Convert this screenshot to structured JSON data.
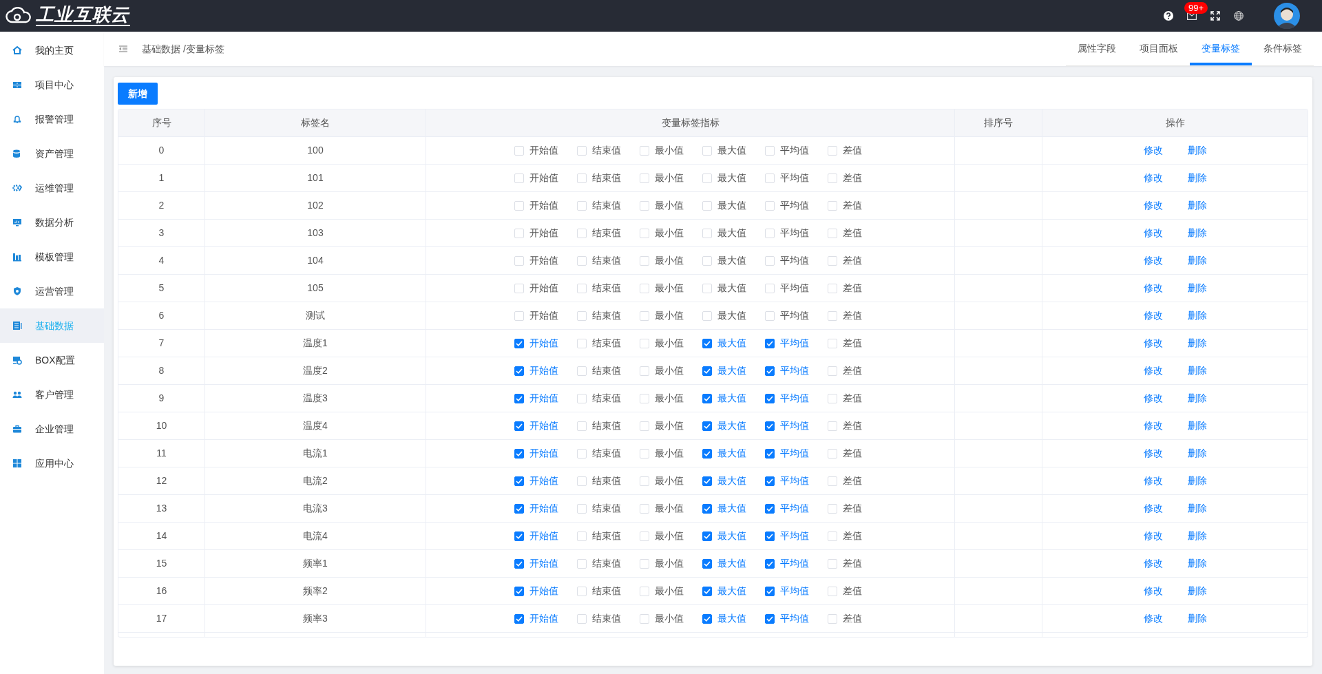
{
  "header": {
    "logo": "工业互联云",
    "notification_badge": "99+"
  },
  "sidebar": {
    "items": [
      {
        "label": "我的主页",
        "selected": false
      },
      {
        "label": "项目中心",
        "selected": false
      },
      {
        "label": "报警管理",
        "selected": false
      },
      {
        "label": "资产管理",
        "selected": false
      },
      {
        "label": "运维管理",
        "selected": false
      },
      {
        "label": "数据分析",
        "selected": false
      },
      {
        "label": "模板管理",
        "selected": false
      },
      {
        "label": "运营管理",
        "selected": false
      },
      {
        "label": "基础数据",
        "selected": true
      },
      {
        "label": "BOX配置",
        "selected": false
      },
      {
        "label": "客户管理",
        "selected": false
      },
      {
        "label": "企业管理",
        "selected": false
      },
      {
        "label": "应用中心",
        "selected": false
      }
    ]
  },
  "breadcrumb": "基础数据 /变量标签",
  "tabs": [
    {
      "label": "属性字段",
      "selected": false
    },
    {
      "label": "项目面板",
      "selected": false
    },
    {
      "label": "变量标签",
      "selected": true
    },
    {
      "label": "条件标签",
      "selected": false
    }
  ],
  "add_button": "新增",
  "table": {
    "columns": [
      "序号",
      "标签名",
      "变量标签指标",
      "排序号",
      "操作"
    ],
    "rows": [
      {
        "index": "0",
        "name": "100",
        "metrics": [
          {
            "label": "开始值",
            "checked": false
          },
          {
            "label": "结束值",
            "checked": false
          },
          {
            "label": "最小值",
            "checked": false
          },
          {
            "label": "最大值",
            "checked": false
          },
          {
            "label": "平均值",
            "checked": false
          },
          {
            "label": "差值",
            "checked": false
          }
        ],
        "actions": [
          "修改",
          "删除"
        ]
      },
      {
        "index": "1",
        "name": "101",
        "metrics": [
          {
            "label": "开始值",
            "checked": false
          },
          {
            "label": "结束值",
            "checked": false
          },
          {
            "label": "最小值",
            "checked": false
          },
          {
            "label": "最大值",
            "checked": false
          },
          {
            "label": "平均值",
            "checked": false
          },
          {
            "label": "差值",
            "checked": false
          }
        ],
        "actions": [
          "修改",
          "删除"
        ]
      },
      {
        "index": "2",
        "name": "102",
        "metrics": [
          {
            "label": "开始值",
            "checked": false
          },
          {
            "label": "结束值",
            "checked": false
          },
          {
            "label": "最小值",
            "checked": false
          },
          {
            "label": "最大值",
            "checked": false
          },
          {
            "label": "平均值",
            "checked": false
          },
          {
            "label": "差值",
            "checked": false
          }
        ],
        "actions": [
          "修改",
          "删除"
        ]
      },
      {
        "index": "3",
        "name": "103",
        "metrics": [
          {
            "label": "开始值",
            "checked": false
          },
          {
            "label": "结束值",
            "checked": false
          },
          {
            "label": "最小值",
            "checked": false
          },
          {
            "label": "最大值",
            "checked": false
          },
          {
            "label": "平均值",
            "checked": false
          },
          {
            "label": "差值",
            "checked": false
          }
        ],
        "actions": [
          "修改",
          "删除"
        ]
      },
      {
        "index": "4",
        "name": "104",
        "metrics": [
          {
            "label": "开始值",
            "checked": false
          },
          {
            "label": "结束值",
            "checked": false
          },
          {
            "label": "最小值",
            "checked": false
          },
          {
            "label": "最大值",
            "checked": false
          },
          {
            "label": "平均值",
            "checked": false
          },
          {
            "label": "差值",
            "checked": false
          }
        ],
        "actions": [
          "修改",
          "删除"
        ]
      },
      {
        "index": "5",
        "name": "105",
        "metrics": [
          {
            "label": "开始值",
            "checked": false
          },
          {
            "label": "结束值",
            "checked": false
          },
          {
            "label": "最小值",
            "checked": false
          },
          {
            "label": "最大值",
            "checked": false
          },
          {
            "label": "平均值",
            "checked": false
          },
          {
            "label": "差值",
            "checked": false
          }
        ],
        "actions": [
          "修改",
          "删除"
        ]
      },
      {
        "index": "6",
        "name": "测试",
        "metrics": [
          {
            "label": "开始值",
            "checked": false
          },
          {
            "label": "结束值",
            "checked": false
          },
          {
            "label": "最小值",
            "checked": false
          },
          {
            "label": "最大值",
            "checked": false
          },
          {
            "label": "平均值",
            "checked": false
          },
          {
            "label": "差值",
            "checked": false
          }
        ],
        "actions": [
          "修改",
          "删除"
        ]
      },
      {
        "index": "7",
        "name": "温度1",
        "metrics": [
          {
            "label": "开始值",
            "checked": true
          },
          {
            "label": "结束值",
            "checked": false
          },
          {
            "label": "最小值",
            "checked": false
          },
          {
            "label": "最大值",
            "checked": true
          },
          {
            "label": "平均值",
            "checked": true
          },
          {
            "label": "差值",
            "checked": false
          }
        ],
        "actions": [
          "修改",
          "删除"
        ]
      },
      {
        "index": "8",
        "name": "温度2",
        "metrics": [
          {
            "label": "开始值",
            "checked": true
          },
          {
            "label": "结束值",
            "checked": false
          },
          {
            "label": "最小值",
            "checked": false
          },
          {
            "label": "最大值",
            "checked": true
          },
          {
            "label": "平均值",
            "checked": true
          },
          {
            "label": "差值",
            "checked": false
          }
        ],
        "actions": [
          "修改",
          "删除"
        ]
      },
      {
        "index": "9",
        "name": "温度3",
        "metrics": [
          {
            "label": "开始值",
            "checked": true
          },
          {
            "label": "结束值",
            "checked": false
          },
          {
            "label": "最小值",
            "checked": false
          },
          {
            "label": "最大值",
            "checked": true
          },
          {
            "label": "平均值",
            "checked": true
          },
          {
            "label": "差值",
            "checked": false
          }
        ],
        "actions": [
          "修改",
          "删除"
        ]
      },
      {
        "index": "10",
        "name": "温度4",
        "metrics": [
          {
            "label": "开始值",
            "checked": true
          },
          {
            "label": "结束值",
            "checked": false
          },
          {
            "label": "最小值",
            "checked": false
          },
          {
            "label": "最大值",
            "checked": true
          },
          {
            "label": "平均值",
            "checked": true
          },
          {
            "label": "差值",
            "checked": false
          }
        ],
        "actions": [
          "修改",
          "删除"
        ]
      },
      {
        "index": "11",
        "name": "电流1",
        "metrics": [
          {
            "label": "开始值",
            "checked": true
          },
          {
            "label": "结束值",
            "checked": false
          },
          {
            "label": "最小值",
            "checked": false
          },
          {
            "label": "最大值",
            "checked": true
          },
          {
            "label": "平均值",
            "checked": true
          },
          {
            "label": "差值",
            "checked": false
          }
        ],
        "actions": [
          "修改",
          "删除"
        ]
      },
      {
        "index": "12",
        "name": "电流2",
        "metrics": [
          {
            "label": "开始值",
            "checked": true
          },
          {
            "label": "结束值",
            "checked": false
          },
          {
            "label": "最小值",
            "checked": false
          },
          {
            "label": "最大值",
            "checked": true
          },
          {
            "label": "平均值",
            "checked": true
          },
          {
            "label": "差值",
            "checked": false
          }
        ],
        "actions": [
          "修改",
          "删除"
        ]
      },
      {
        "index": "13",
        "name": "电流3",
        "metrics": [
          {
            "label": "开始值",
            "checked": true
          },
          {
            "label": "结束值",
            "checked": false
          },
          {
            "label": "最小值",
            "checked": false
          },
          {
            "label": "最大值",
            "checked": true
          },
          {
            "label": "平均值",
            "checked": true
          },
          {
            "label": "差值",
            "checked": false
          }
        ],
        "actions": [
          "修改",
          "删除"
        ]
      },
      {
        "index": "14",
        "name": "电流4",
        "metrics": [
          {
            "label": "开始值",
            "checked": true
          },
          {
            "label": "结束值",
            "checked": false
          },
          {
            "label": "最小值",
            "checked": false
          },
          {
            "label": "最大值",
            "checked": true
          },
          {
            "label": "平均值",
            "checked": true
          },
          {
            "label": "差值",
            "checked": false
          }
        ],
        "actions": [
          "修改",
          "删除"
        ]
      },
      {
        "index": "15",
        "name": "频率1",
        "metrics": [
          {
            "label": "开始值",
            "checked": true
          },
          {
            "label": "结束值",
            "checked": false
          },
          {
            "label": "最小值",
            "checked": false
          },
          {
            "label": "最大值",
            "checked": true
          },
          {
            "label": "平均值",
            "checked": true
          },
          {
            "label": "差值",
            "checked": false
          }
        ],
        "actions": [
          "修改",
          "删除"
        ]
      },
      {
        "index": "16",
        "name": "频率2",
        "metrics": [
          {
            "label": "开始值",
            "checked": true
          },
          {
            "label": "结束值",
            "checked": false
          },
          {
            "label": "最小值",
            "checked": false
          },
          {
            "label": "最大值",
            "checked": true
          },
          {
            "label": "平均值",
            "checked": true
          },
          {
            "label": "差值",
            "checked": false
          }
        ],
        "actions": [
          "修改",
          "删除"
        ]
      },
      {
        "index": "17",
        "name": "频率3",
        "metrics": [
          {
            "label": "开始值",
            "checked": true
          },
          {
            "label": "结束值",
            "checked": false
          },
          {
            "label": "最小值",
            "checked": false
          },
          {
            "label": "最大值",
            "checked": true
          },
          {
            "label": "平均值",
            "checked": true
          },
          {
            "label": "差值",
            "checked": false
          }
        ],
        "actions": [
          "修改",
          "删除"
        ]
      }
    ]
  }
}
